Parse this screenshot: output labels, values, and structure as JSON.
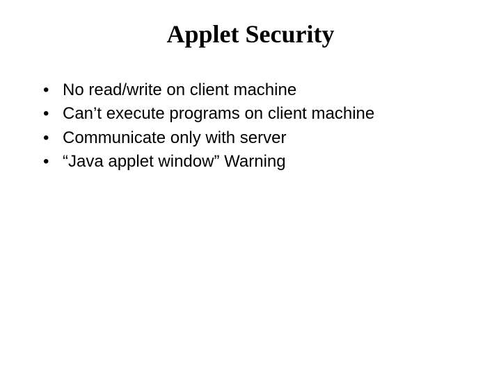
{
  "slide": {
    "title": "Applet Security",
    "bullets": [
      "No read/write on client machine",
      "Can’t execute programs on client machine",
      "Communicate only with server",
      "“Java applet window” Warning"
    ]
  }
}
